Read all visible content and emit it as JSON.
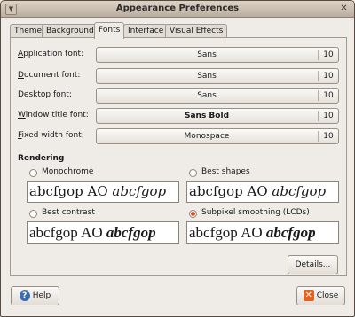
{
  "window": {
    "title": "Appearance Preferences",
    "menu_icon": "window-menu-icon",
    "close_icon": "window-close-icon"
  },
  "tabs": [
    {
      "label": "Theme",
      "accel": "",
      "active": false
    },
    {
      "label": "Background",
      "accel": "",
      "active": false
    },
    {
      "label": "Fonts",
      "accel": "",
      "active": true
    },
    {
      "label": "Interface",
      "accel": "",
      "active": false
    },
    {
      "label": "Visual Effects",
      "accel": "",
      "active": false
    }
  ],
  "fonts": [
    {
      "key": "A",
      "label_rest": "pplication font:",
      "font": "Sans",
      "size": "10",
      "bold": false
    },
    {
      "key": "D",
      "label_rest": "ocument font:",
      "font": "Sans",
      "size": "10",
      "bold": false
    },
    {
      "key": "Des",
      "label_rest": "ktop font:",
      "font": "Sans",
      "size": "10",
      "bold": false
    },
    {
      "key": "W",
      "label_rest": "indow title font:",
      "font": "Sans Bold",
      "size": "10",
      "bold": true
    },
    {
      "key": "F",
      "label_rest": "ixed width font:",
      "font": "Monospace",
      "size": "10",
      "bold": false
    }
  ],
  "rendering": {
    "title": "Rendering",
    "sample_text": "abcfgop AO ",
    "sample_italic": "abcfgop",
    "options": [
      {
        "label": "Monochrome",
        "checked": false
      },
      {
        "label": "Best shapes",
        "checked": false
      },
      {
        "label": "Best contrast",
        "checked": false
      },
      {
        "label": "Subpixel smoothing (LCDs)",
        "checked": true
      }
    ]
  },
  "buttons": {
    "details": "Details...",
    "help": "Help",
    "close": "Close"
  }
}
